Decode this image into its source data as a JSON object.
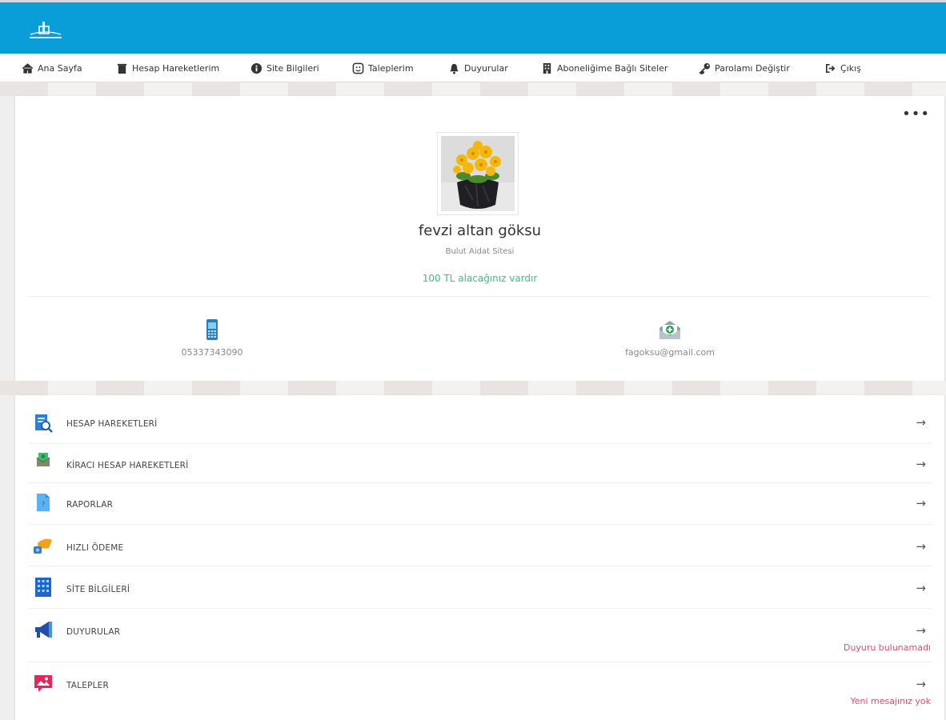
{
  "nav": {
    "items": [
      {
        "label": "Ana Sayfa",
        "icon": "home-icon"
      },
      {
        "label": "Hesap Hareketlerim",
        "icon": "trash-icon"
      },
      {
        "label": "Site Bilgileri",
        "icon": "info-icon"
      },
      {
        "label": "Taleplerim",
        "icon": "smile-icon"
      },
      {
        "label": "Duyurular",
        "icon": "bell-icon"
      },
      {
        "label": "Aboneliğime Bağlı Siteler",
        "icon": "building-icon"
      },
      {
        "label": "Parolamı Değiştir",
        "icon": "key-icon"
      },
      {
        "label": "Çıkış",
        "icon": "sign-out-icon"
      }
    ]
  },
  "profile": {
    "name": "fevzi altan göksu",
    "site": "Bulut Aidat Sitesi",
    "balance": "100 TL alacağınız vardır",
    "phone": "05337343090",
    "email": "fagoksu@gmail.com",
    "more": "•••"
  },
  "menu": {
    "arrow": "→",
    "items": [
      {
        "label": "HESAP HAREKETLERİ",
        "icon": "document-search-icon"
      },
      {
        "label": "KİRACI HESAP HAREKETLERİ",
        "icon": "money-envelope-icon"
      },
      {
        "label": "RAPORLAR",
        "icon": "report-icon"
      },
      {
        "label": "HIZLI ÖDEME",
        "icon": "payment-card-icon"
      },
      {
        "label": "SİTE BİLGİLERİ",
        "icon": "building-grid-icon"
      },
      {
        "label": "DUYURULAR",
        "icon": "megaphone-icon",
        "note": "Duyuru bulunamadı"
      },
      {
        "label": "TALEPLER",
        "icon": "image-request-icon",
        "note": "Yeni mesajınız yok"
      }
    ]
  },
  "colors": {
    "header": "#0a9ed8",
    "balance": "#3cc07a",
    "note": "#e94b68"
  }
}
